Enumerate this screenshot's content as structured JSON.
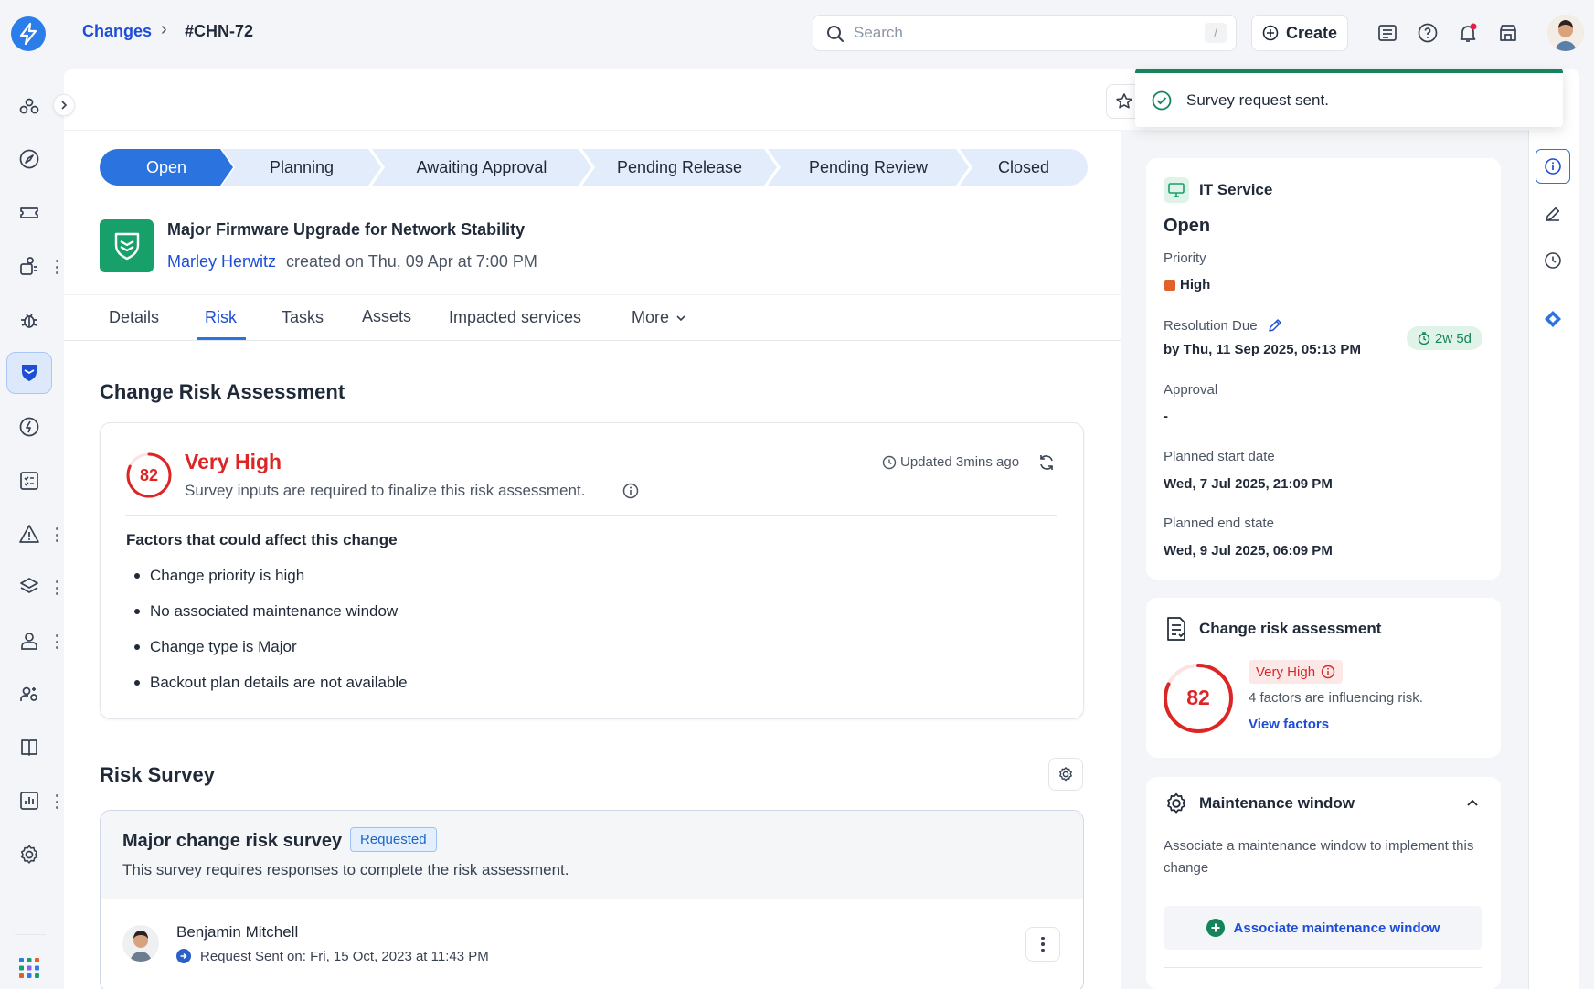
{
  "breadcrumb": {
    "parent": "Changes",
    "separator": "›",
    "current": "#CHN-72"
  },
  "search": {
    "placeholder": "Search",
    "shortcut": "/"
  },
  "header_actions": {
    "create_label": "Create"
  },
  "toast": {
    "message": "Survey request sent."
  },
  "stepper": {
    "steps": [
      "Open",
      "Planning",
      "Awaiting Approval",
      "Pending Release",
      "Pending Review",
      "Closed"
    ],
    "active_index": 0
  },
  "change": {
    "title": "Major Firmware Upgrade for Network Stability",
    "author": "Marley Herwitz",
    "created_text": "created on Thu, 09 Apr at 7:00 PM"
  },
  "tabs": {
    "items": [
      "Details",
      "Risk",
      "Tasks",
      "Assets",
      "Impacted services",
      "More"
    ],
    "active": "Risk"
  },
  "risk_assessment": {
    "section_title": "Change Risk Assessment",
    "score": "82",
    "score_fraction": 0.82,
    "level": "Very High",
    "subtitle": "Survey inputs are required to finalize this risk assessment.",
    "updated": "Updated 3mins ago",
    "factors_title": "Factors that could affect this change",
    "factors": [
      "Change priority is high",
      "No associated maintenance window",
      "Change type is Major",
      "Backout plan details are not available"
    ]
  },
  "risk_survey": {
    "section_title": "Risk Survey",
    "survey_title": "Major change risk survey",
    "status_badge": "Requested",
    "description": "This survey requires responses to complete the risk assessment.",
    "respondent": {
      "name": "Benjamin Mitchell",
      "request_text": "Request Sent on: Fri, 15 Oct, 2023 at 11:43 PM"
    }
  },
  "details_panel": {
    "service": "IT Service",
    "status": "Open",
    "priority_label": "Priority",
    "priority_value": "High",
    "resolution_label": "Resolution Due",
    "resolution_value": "by Thu, 11 Sep 2025, 05:13 PM",
    "resolution_badge": "2w 5d",
    "approval_label": "Approval",
    "approval_value": "-",
    "planned_start_label": "Planned start date",
    "planned_start_value": "Wed, 7 Jul 2025, 21:09 PM",
    "planned_end_label": "Planned end state",
    "planned_end_value": "Wed, 9 Jul 2025, 06:09 PM"
  },
  "risk_card": {
    "title": "Change risk assessment",
    "score": "82",
    "score_fraction": 0.82,
    "level": "Very High",
    "factors_text": "4 factors are influencing risk.",
    "link": "View factors"
  },
  "maintenance": {
    "title": "Maintenance window",
    "description": "Associate a maintenance window to implement this change",
    "button": "Associate maintenance window"
  },
  "colors": {
    "primary": "#2b74e0",
    "danger": "#dc2626",
    "success": "#14845d",
    "priority_high": "#e0622a"
  }
}
